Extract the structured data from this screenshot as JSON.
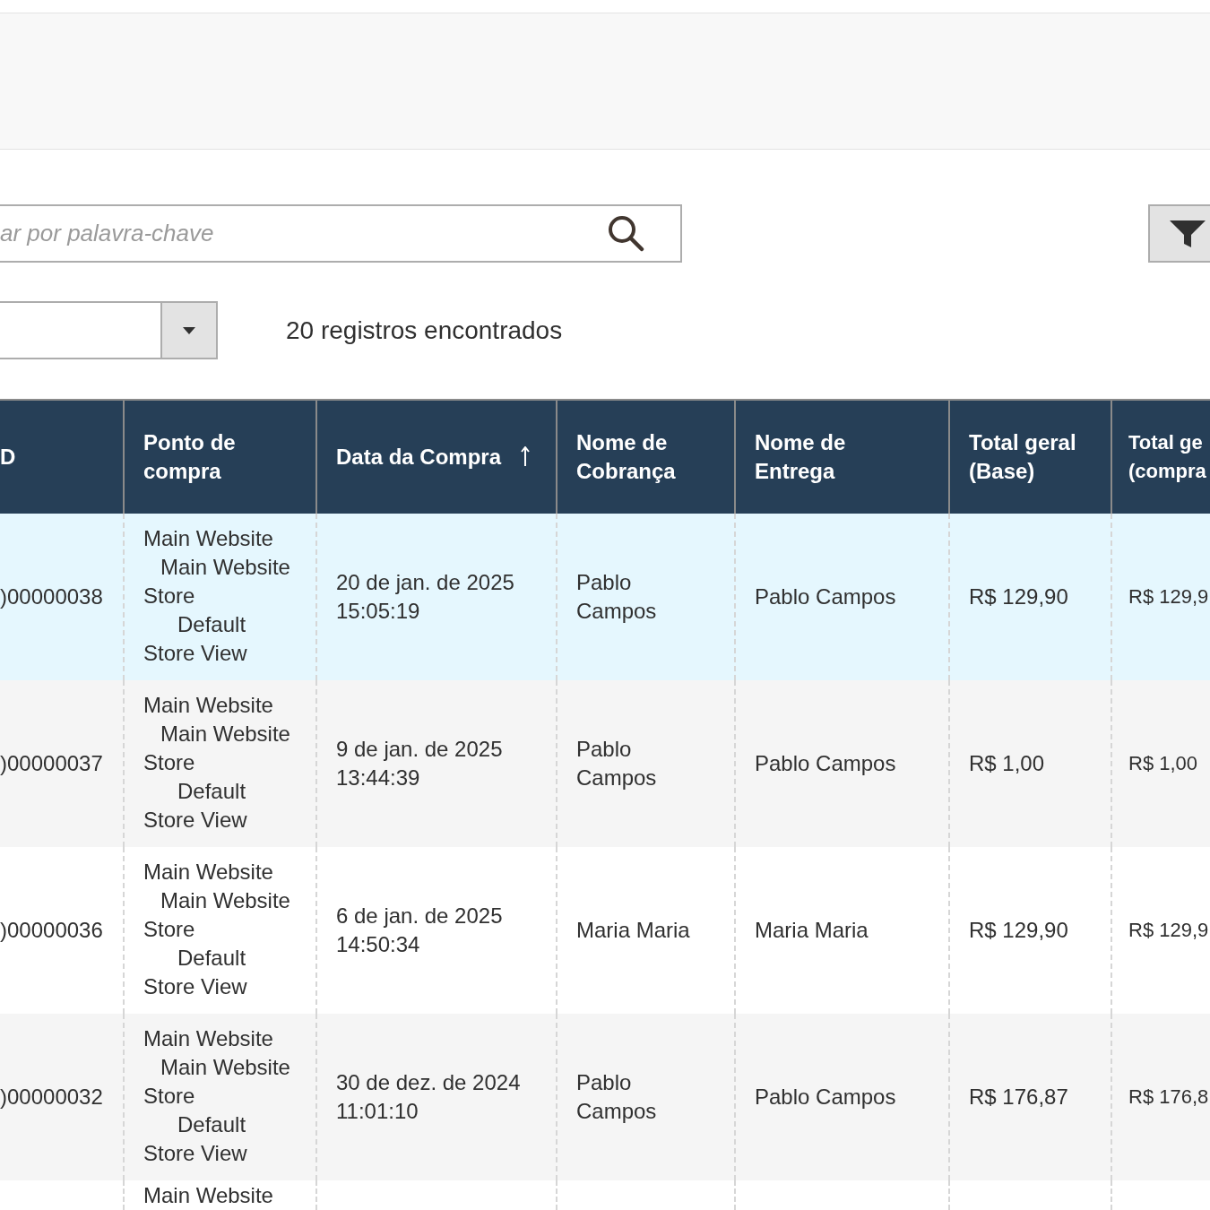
{
  "search": {
    "placeholder": "ar por palavra-chave"
  },
  "filters_button": {
    "kind": "funnel"
  },
  "records_count": "20 registros encontrados",
  "table": {
    "columns": [
      {
        "label": "D",
        "sorted": false
      },
      {
        "label": "Ponto de compra",
        "sorted": false
      },
      {
        "label": "Data da Compra",
        "sorted": true
      },
      {
        "label": "Nome de Cobrança",
        "sorted": false
      },
      {
        "label": "Nome de Entrega",
        "sorted": false
      },
      {
        "label": "Total geral (Base)",
        "sorted": false
      },
      {
        "label": "Total ge (compra",
        "sorted": false
      }
    ],
    "rows": [
      {
        "selected": true,
        "id": ")00000038",
        "store": [
          "Main Website",
          "Main Website Store",
          "Default Store View"
        ],
        "date": "20 de jan. de 2025 15:05:19",
        "billing": "Pablo Campos",
        "shipping": "Pablo Campos",
        "total_base": "R$ 129,90",
        "total_purchased": "R$ 129,9"
      },
      {
        "selected": false,
        "id": ")00000037",
        "store": [
          "Main Website",
          "Main Website Store",
          "Default Store View"
        ],
        "date": "9 de jan. de 2025 13:44:39",
        "billing": "Pablo Campos",
        "shipping": "Pablo Campos",
        "total_base": "R$ 1,00",
        "total_purchased": "R$ 1,00"
      },
      {
        "selected": false,
        "id": ")00000036",
        "store": [
          "Main Website",
          "Main Website Store",
          "Default Store View"
        ],
        "date": "6 de jan. de 2025 14:50:34",
        "billing": "Maria Maria",
        "shipping": "Maria Maria",
        "total_base": "R$ 129,90",
        "total_purchased": "R$ 129,9"
      },
      {
        "selected": false,
        "id": ")00000032",
        "store": [
          "Main Website",
          "Main Website Store",
          "Default Store View"
        ],
        "date": "30 de dez. de 2024 11:01:10",
        "billing": "Pablo Campos",
        "shipping": "Pablo Campos",
        "total_base": "R$ 176,87",
        "total_purchased": "R$ 176,8"
      },
      {
        "selected": false,
        "store": [
          "Main Website"
        ]
      }
    ]
  }
}
